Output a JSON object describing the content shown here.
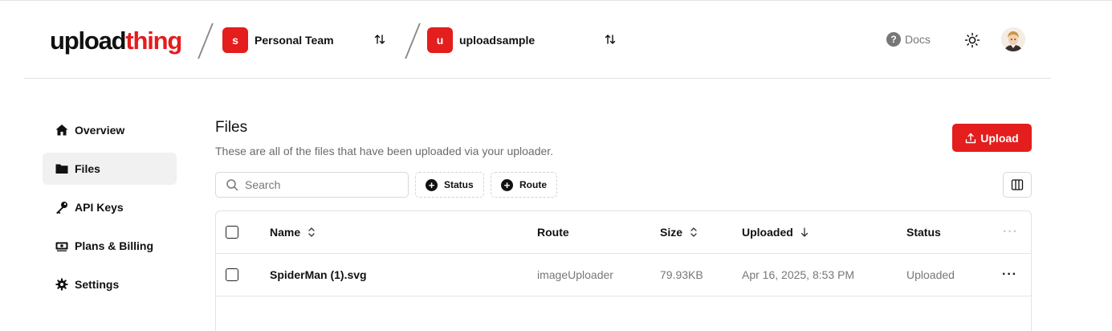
{
  "header": {
    "logo_part1": "upload",
    "logo_part2": "thing",
    "team": {
      "initial": "s",
      "name": "Personal Team"
    },
    "app": {
      "initial": "u",
      "name": "uploadsample"
    },
    "docs_label": "Docs"
  },
  "sidebar": {
    "items": [
      {
        "label": "Overview",
        "icon": "home-icon"
      },
      {
        "label": "Files",
        "icon": "folder-icon",
        "active": true
      },
      {
        "label": "API Keys",
        "icon": "key-icon"
      },
      {
        "label": "Plans & Billing",
        "icon": "billing-icon"
      },
      {
        "label": "Settings",
        "icon": "gear-icon"
      }
    ]
  },
  "main": {
    "title": "Files",
    "subtitle": "These are all of the files that have been uploaded via your uploader.",
    "upload_label": "Upload",
    "search_placeholder": "Search",
    "filters": [
      "Status",
      "Route"
    ]
  },
  "table": {
    "columns": [
      "Name",
      "Route",
      "Size",
      "Uploaded",
      "Status"
    ],
    "rows": [
      {
        "name": "SpiderMan (1).svg",
        "route": "imageUploader",
        "size": "79.93KB",
        "uploaded": "Apr 16, 2025, 8:53 PM",
        "status": "Uploaded"
      }
    ]
  },
  "colors": {
    "accent": "#e41d1d"
  }
}
